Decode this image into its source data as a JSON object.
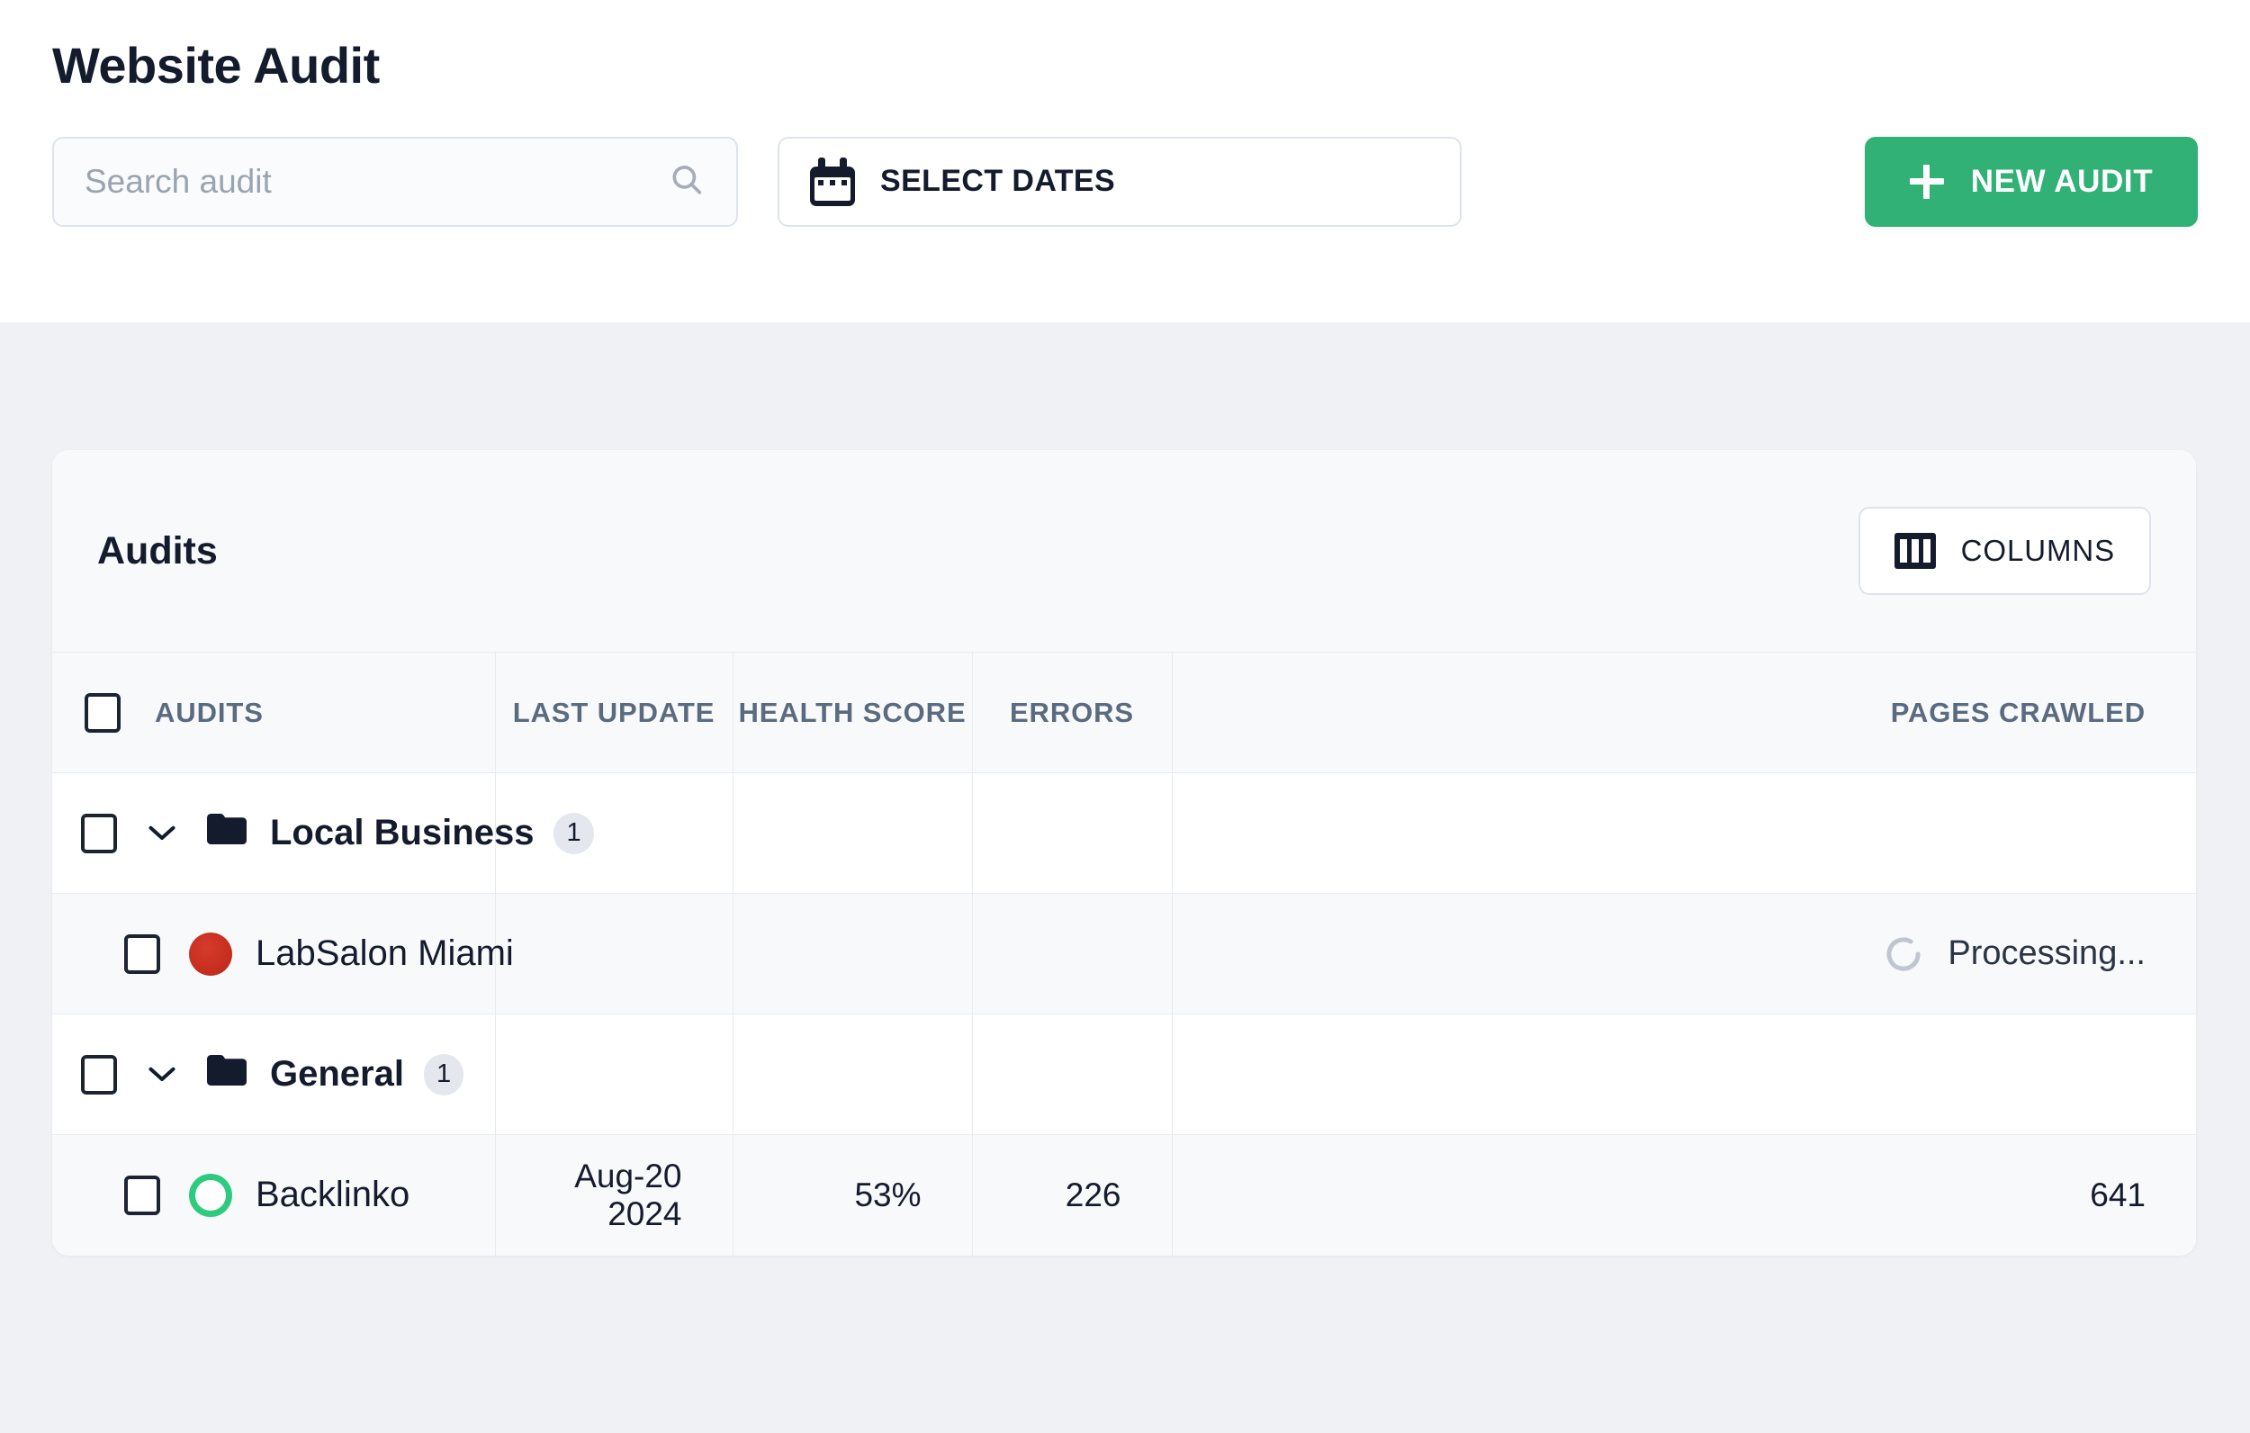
{
  "page": {
    "title": "Website Audit",
    "background_color": "#eff1f5",
    "accent_color": "#31b176"
  },
  "toolbar": {
    "search": {
      "placeholder": "Search audit",
      "value": "",
      "icon": "search-icon"
    },
    "select_dates": {
      "label": "SELECT DATES",
      "icon": "calendar-icon"
    },
    "new_audit": {
      "label": "NEW AUDIT",
      "icon": "plus-icon",
      "color": "#31b176"
    }
  },
  "card": {
    "title": "Audits",
    "columns_button": {
      "label": "COLUMNS",
      "icon": "columns-icon"
    }
  },
  "table": {
    "headers": {
      "name": "AUDITS",
      "last_update": "LAST UPDATE",
      "health_score": "HEALTH SCORE",
      "errors": "ERRORS",
      "pages_crawled": "PAGES CRAWLED"
    },
    "rows": [
      {
        "type": "folder",
        "name": "Local Business",
        "count": "1",
        "expanded": true,
        "last_update": "",
        "health_score": "",
        "errors": "",
        "pages_crawled": ""
      },
      {
        "type": "site",
        "name": "LabSalon Miami",
        "favicon": "labsalon-favicon",
        "last_update": "",
        "health_score": "",
        "errors": "",
        "pages_crawled": "Processing...",
        "status_icon": "spinner-icon"
      },
      {
        "type": "folder",
        "name": "General",
        "count": "1",
        "expanded": true,
        "last_update": "",
        "health_score": "",
        "errors": "",
        "pages_crawled": ""
      },
      {
        "type": "site",
        "name": "Backlinko",
        "favicon": "backlinko-favicon",
        "last_update": "Aug-20 2024",
        "health_score": "53%",
        "errors": "226",
        "pages_crawled": "641"
      }
    ]
  }
}
